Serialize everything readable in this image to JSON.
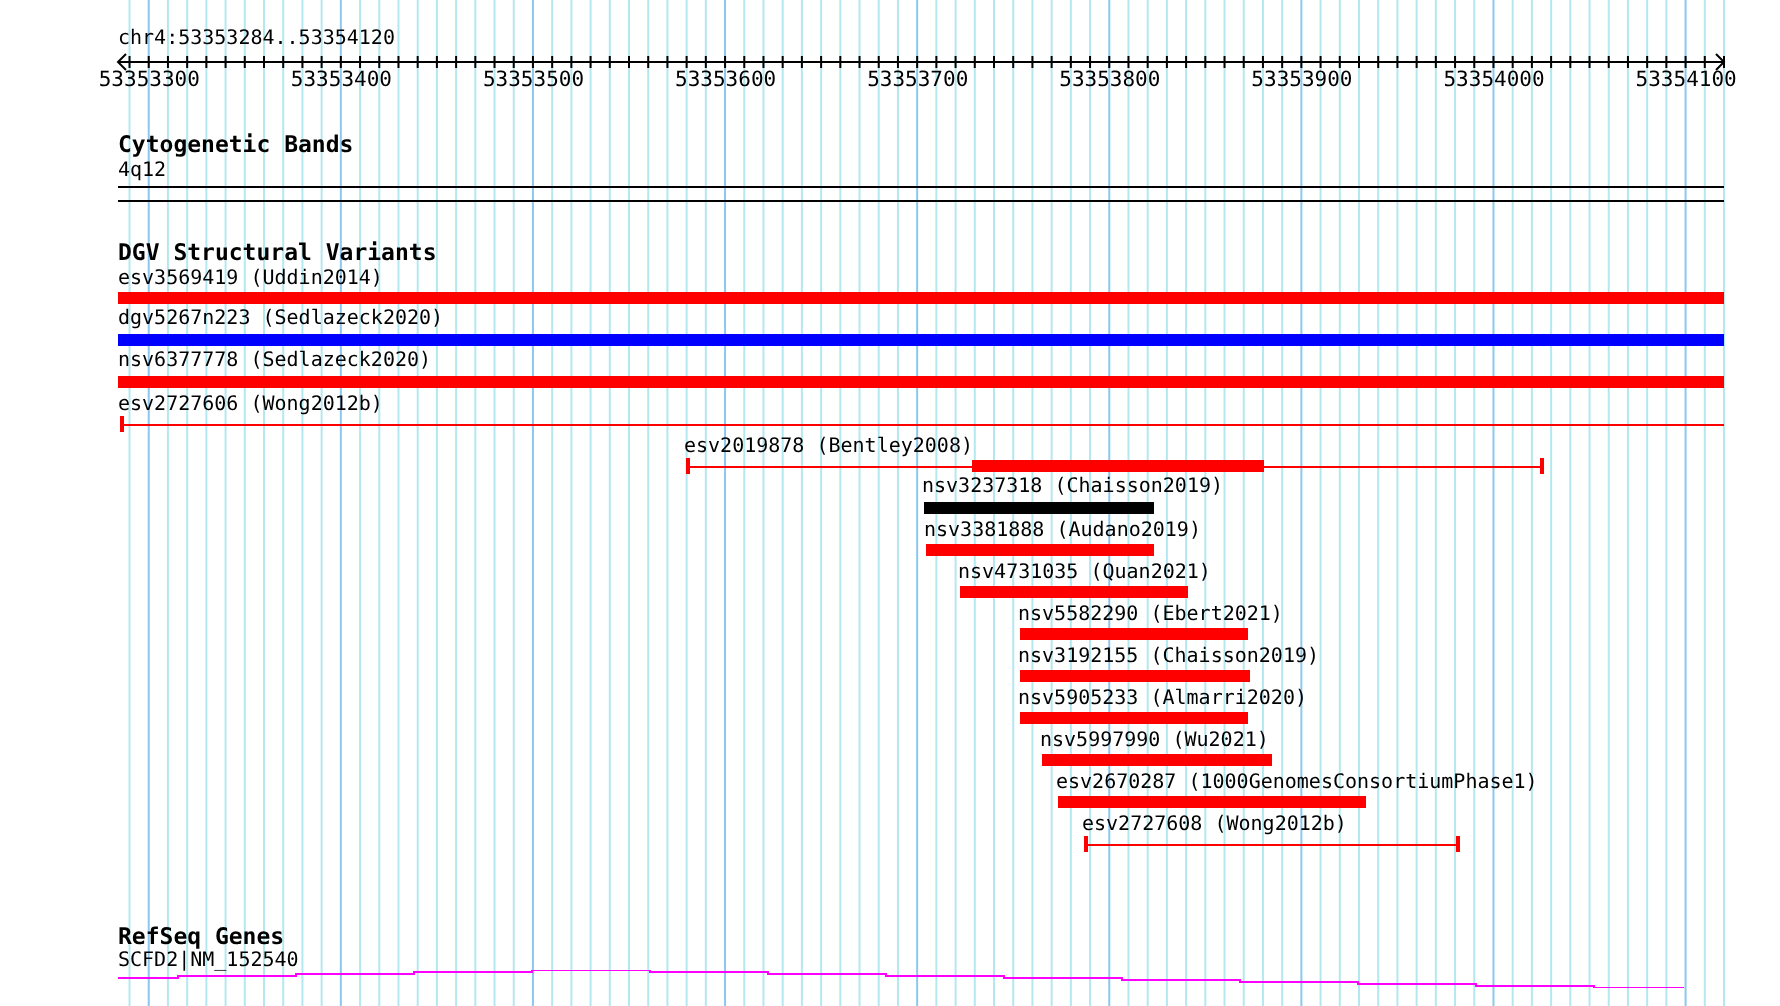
{
  "ruler": {
    "title": "chr4:53353284..53354120",
    "ticks": [
      "53353300",
      "53353400",
      "53353500",
      "53353600",
      "53353700",
      "53353800",
      "53353900",
      "53354000",
      "53354100"
    ]
  },
  "cytogenetic_bands": {
    "title": "Cytogenetic Bands",
    "items": [
      {
        "label": "4q12"
      }
    ]
  },
  "dgv_structural_variants": {
    "title": "DGV Structural Variants",
    "items": [
      {
        "label": "esv3569419 (Uddin2014)",
        "kind": "bar",
        "color": "#ff0000"
      },
      {
        "label": "dgv5267n223 (Sedlazeck2020)",
        "kind": "bar",
        "color": "#0000ff"
      },
      {
        "label": "nsv6377778 (Sedlazeck2020)",
        "kind": "bar",
        "color": "#ff0000"
      },
      {
        "label": "esv2727606 (Wong2012b)",
        "kind": "line",
        "color": "#ff0000"
      },
      {
        "label": "esv2019878 (Bentley2008)",
        "kind": "line-bar",
        "color": "#ff0000"
      },
      {
        "label": "nsv3237318 (Chaisson2019)",
        "kind": "bar",
        "color": "#000000"
      },
      {
        "label": "nsv3381888 (Audano2019)",
        "kind": "bar",
        "color": "#ff0000"
      },
      {
        "label": "nsv4731035 (Quan2021)",
        "kind": "bar",
        "color": "#ff0000"
      },
      {
        "label": "nsv5582290 (Ebert2021)",
        "kind": "bar",
        "color": "#ff0000"
      },
      {
        "label": "nsv3192155 (Chaisson2019)",
        "kind": "bar",
        "color": "#ff0000"
      },
      {
        "label": "nsv5905233 (Almarri2020)",
        "kind": "bar",
        "color": "#ff0000"
      },
      {
        "label": "nsv5997990 (Wu2021)",
        "kind": "bar",
        "color": "#ff0000"
      },
      {
        "label": "esv2670287 (1000GenomesConsortiumPhase1)",
        "kind": "bar",
        "color": "#ff0000"
      },
      {
        "label": "esv2727608 (Wong2012b)",
        "kind": "line",
        "color": "#ff0000"
      }
    ]
  },
  "refseq_genes": {
    "title": "RefSeq Genes",
    "items": [
      {
        "label": "SCFD2|NM_152540"
      }
    ]
  }
}
